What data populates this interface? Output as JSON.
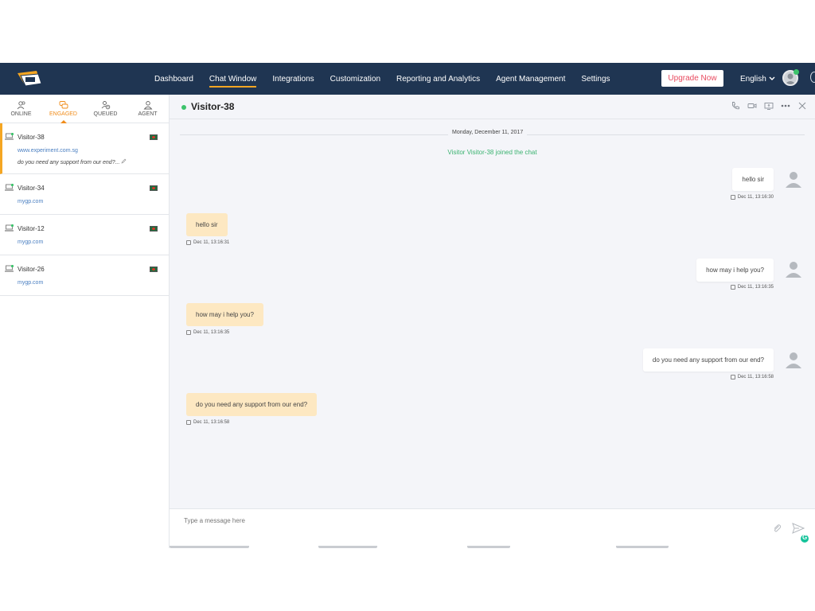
{
  "nav": {
    "items": [
      {
        "label": "Dashboard",
        "active": false
      },
      {
        "label": "Chat Window",
        "active": true
      },
      {
        "label": "Integrations",
        "active": false
      },
      {
        "label": "Customization",
        "active": false
      },
      {
        "label": "Reporting and Analytics",
        "active": false
      },
      {
        "label": "Agent Management",
        "active": false
      },
      {
        "label": "Settings",
        "active": false
      }
    ],
    "upgrade_label": "Upgrade Now",
    "language": "English"
  },
  "tabs": [
    {
      "label": "ONLINE",
      "icon": "users-icon",
      "active": false
    },
    {
      "label": "ENGAGED",
      "icon": "chat-bubbles-icon",
      "active": true
    },
    {
      "label": "QUEUED",
      "icon": "user-clock-icon",
      "active": false
    },
    {
      "label": "AGENT",
      "icon": "user-icon",
      "active": false
    }
  ],
  "visitors": [
    {
      "name": "Visitor-38",
      "site": "www.experiment.com.sg",
      "last_message": "do you need any support from our end?...",
      "active": true
    },
    {
      "name": "Visitor-34",
      "site": "mygp.com",
      "last_message": "",
      "active": false
    },
    {
      "name": "Visitor-12",
      "site": "mygp.com",
      "last_message": "",
      "active": false
    },
    {
      "name": "Visitor-26",
      "site": "mygp.com",
      "last_message": "",
      "active": false
    }
  ],
  "chat": {
    "title": "Visitor-38",
    "date": "Monday, December 11, 2017",
    "joined": "Visitor Visitor-38 joined the chat",
    "messages": [
      {
        "text": "hello sir",
        "time": "Dec 11, 13:16:30",
        "from": "agent"
      },
      {
        "text": "hello sir",
        "time": "Dec 11, 13:16:31",
        "from": "visitor"
      },
      {
        "text": "how may i help you?",
        "time": "Dec 11, 13:16:35",
        "from": "agent"
      },
      {
        "text": "how may i help you?",
        "time": "Dec 11, 13:16:35",
        "from": "visitor"
      },
      {
        "text": "do you need any support from our end?",
        "time": "Dec 11, 13:16:58",
        "from": "agent"
      },
      {
        "text": "do you need any support from our end?",
        "time": "Dec 11, 13:16:58",
        "from": "visitor"
      }
    ],
    "composer_placeholder": "Type a message here"
  },
  "colors": {
    "nav_bg": "#1f3552",
    "accent_orange": "#f5a623",
    "online_green": "#3cc36b",
    "visitor_bubble": "#fde8c2",
    "link_blue": "#4a7fc1"
  }
}
